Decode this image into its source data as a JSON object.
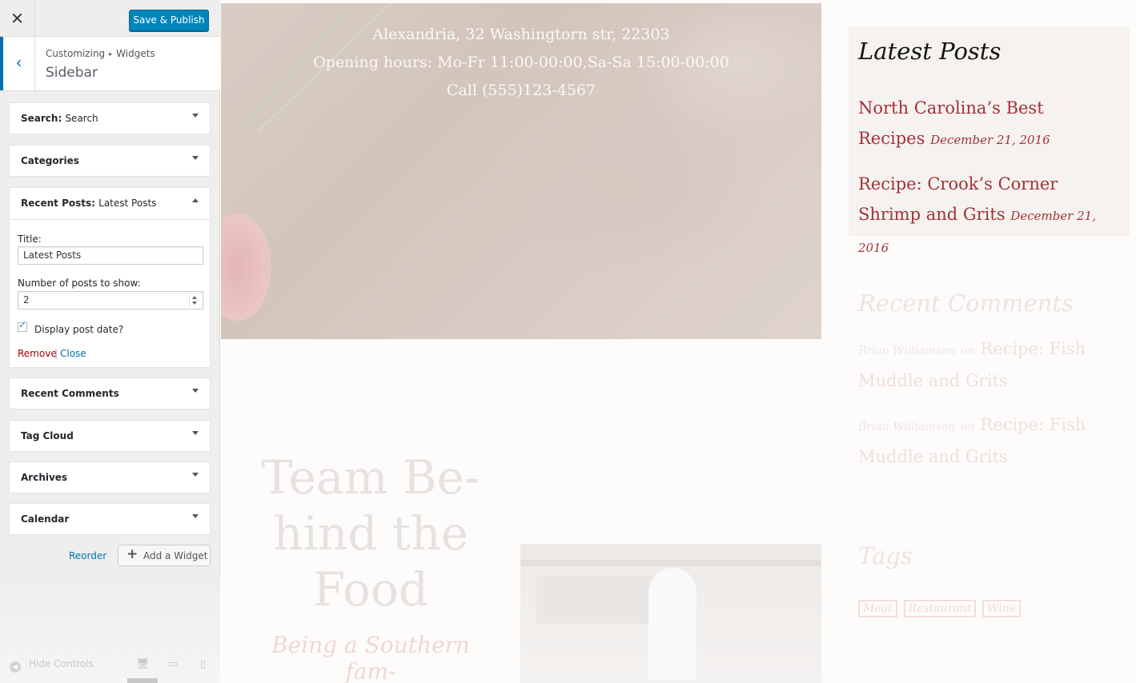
{
  "customizer": {
    "close_icon": "close-icon",
    "publish_label": "Save & Publish",
    "breadcrumb": {
      "parent": "Customizing",
      "child": "Widgets"
    },
    "section_title": "Sidebar",
    "widgets": [
      {
        "type": "Search",
        "title": "Search"
      },
      {
        "type": "Categories",
        "title": ""
      },
      {
        "type": "Recent Posts",
        "title": "Latest Posts"
      },
      {
        "type": "Recent Comments",
        "title": ""
      },
      {
        "type": "Tag Cloud",
        "title": ""
      },
      {
        "type": "Archives",
        "title": ""
      },
      {
        "type": "Calendar",
        "title": ""
      }
    ],
    "recent_posts_form": {
      "title_label": "Title:",
      "title_value": "Latest Posts",
      "count_label": "Number of posts to show:",
      "count_value": "2",
      "show_date_label": "Display post date?",
      "show_date_checked": true,
      "remove_label": "Remove",
      "separator": "|",
      "close_label": "Close"
    },
    "reorder_label": "Reorder",
    "add_widget_label": "Add a Widget",
    "hide_controls_label": "Hide Controls",
    "preview_device": "desktop"
  },
  "preview": {
    "hero": {
      "address": "Alexandria, 32 Washingtorn str, 22303",
      "hours": "Opening hours: Mo-Fr 11:00-00:00,Sa-Sa 15:00-00:00",
      "call": "Call (555)123-4567"
    },
    "team_heading": "Team Be- hind the Food",
    "team_sub": "Being a Southern fam-",
    "latest_posts": {
      "title": "Latest Posts",
      "posts": [
        {
          "title": "North Carolina’s Best Recipes",
          "date": "December 21, 2016"
        },
        {
          "title": "Recipe: Crook’s Corner Shrimp and Grits",
          "date": "December 21, 2016"
        }
      ]
    },
    "recent_comments": {
      "title": "Recent Comments",
      "items": [
        {
          "author": "Brian Williamson",
          "on": "on",
          "post": "Recipe: Fish Muddle and Grits"
        },
        {
          "author": "Brian Williamson",
          "on": "on",
          "post": "Recipe: Fish Muddle and Grits"
        }
      ]
    },
    "tags": {
      "title": "Tags",
      "items": [
        "Meat",
        "Restaurant",
        "Wine"
      ]
    }
  },
  "colors": {
    "accent": "#0085ba",
    "link": "#0073aa",
    "post_link": "#a3323a",
    "remove": "#aa0000"
  }
}
